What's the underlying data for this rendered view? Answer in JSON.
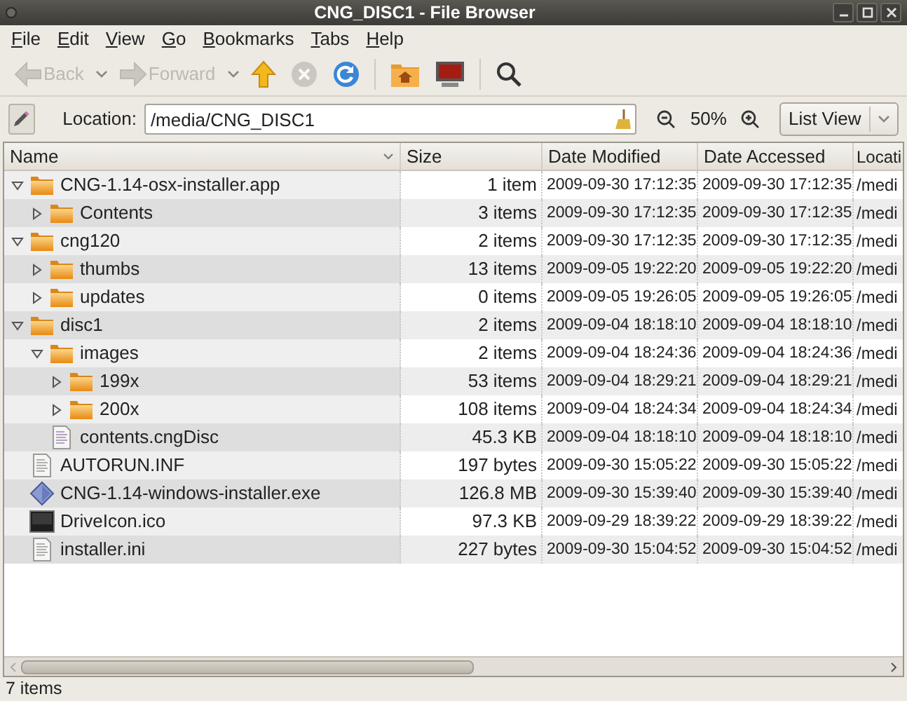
{
  "window": {
    "title": "CNG_DISC1 - File Browser"
  },
  "menu": [
    "File",
    "Edit",
    "View",
    "Go",
    "Bookmarks",
    "Tabs",
    "Help"
  ],
  "toolbar": [
    {
      "kind": "back",
      "label": "Back",
      "disabled": true
    },
    {
      "kind": "forward",
      "label": "Forward",
      "disabled": true
    },
    {
      "kind": "up",
      "disabled": false
    },
    {
      "kind": "stop",
      "disabled": true
    },
    {
      "kind": "reload",
      "disabled": false
    },
    {
      "kind": "sep"
    },
    {
      "kind": "home",
      "disabled": false
    },
    {
      "kind": "computer",
      "disabled": false
    },
    {
      "kind": "sep"
    },
    {
      "kind": "search",
      "disabled": false
    }
  ],
  "location": {
    "label": "Location:",
    "value": "/media/CNG_DISC1"
  },
  "zoom": {
    "value": "50%"
  },
  "view_select": {
    "value": "List View"
  },
  "table": {
    "columns": [
      {
        "label": "Name",
        "sorted": true
      },
      {
        "label": "Size",
        "sorted": false
      },
      {
        "label": "Date Modified",
        "sorted": false
      },
      {
        "label": "Date Accessed",
        "sorted": false
      },
      {
        "label": "Locati",
        "sorted": false
      }
    ],
    "rows": [
      {
        "kind": "folder",
        "name": "CNG-1.14-osx-installer.app",
        "size": "1 item",
        "modified": "2009-09-30 17:12:35",
        "accessed": "2009-09-30 17:12:35",
        "location": "/medi",
        "expanded": true,
        "children": [
          {
            "kind": "folder",
            "name": "Contents",
            "size": "3 items",
            "modified": "2009-09-30 17:12:35",
            "accessed": "2009-09-30 17:12:35",
            "location": "/medi",
            "expanded": false
          }
        ]
      },
      {
        "kind": "folder",
        "name": "cng120",
        "size": "2 items",
        "modified": "2009-09-30 17:12:35",
        "accessed": "2009-09-30 17:12:35",
        "location": "/medi",
        "expanded": true,
        "children": [
          {
            "kind": "folder",
            "name": "thumbs",
            "size": "13 items",
            "modified": "2009-09-05 19:22:20",
            "accessed": "2009-09-05 19:22:20",
            "location": "/medi",
            "expanded": false
          },
          {
            "kind": "folder",
            "name": "updates",
            "size": "0 items",
            "modified": "2009-09-05 19:26:05",
            "accessed": "2009-09-05 19:26:05",
            "location": "/medi",
            "expanded": false
          }
        ]
      },
      {
        "kind": "folder",
        "name": "disc1",
        "size": "2 items",
        "modified": "2009-09-04 18:18:10",
        "accessed": "2009-09-04 18:18:10",
        "location": "/medi",
        "expanded": true,
        "children": [
          {
            "kind": "folder",
            "name": "images",
            "size": "2 items",
            "modified": "2009-09-04 18:24:36",
            "accessed": "2009-09-04 18:24:36",
            "location": "/medi",
            "expanded": true,
            "children": [
              {
                "kind": "folder",
                "name": "199x",
                "size": "53 items",
                "modified": "2009-09-04 18:29:21",
                "accessed": "2009-09-04 18:29:21",
                "location": "/medi",
                "expanded": false
              },
              {
                "kind": "folder",
                "name": "200x",
                "size": "108 items",
                "modified": "2009-09-04 18:24:34",
                "accessed": "2009-09-04 18:24:34",
                "location": "/medi",
                "expanded": false
              }
            ]
          },
          {
            "kind": "document",
            "name": "contents.cngDisc",
            "size": "45.3 KB",
            "modified": "2009-09-04 18:18:10",
            "accessed": "2009-09-04 18:18:10",
            "location": "/medi"
          }
        ]
      },
      {
        "kind": "text",
        "name": "AUTORUN.INF",
        "size": "197 bytes",
        "modified": "2009-09-30 15:05:22",
        "accessed": "2009-09-30 15:05:22",
        "location": "/medi"
      },
      {
        "kind": "executable",
        "name": "CNG-1.14-windows-installer.exe",
        "size": "126.8 MB",
        "modified": "2009-09-30 15:39:40",
        "accessed": "2009-09-30 15:39:40",
        "location": "/medi"
      },
      {
        "kind": "image",
        "name": "DriveIcon.ico",
        "size": "97.3 KB",
        "modified": "2009-09-29 18:39:22",
        "accessed": "2009-09-29 18:39:22",
        "location": "/medi"
      },
      {
        "kind": "text",
        "name": "installer.ini",
        "size": "227 bytes",
        "modified": "2009-09-30 15:04:52",
        "accessed": "2009-09-30 15:04:52",
        "location": "/medi"
      }
    ]
  },
  "status_bar": "7 items"
}
